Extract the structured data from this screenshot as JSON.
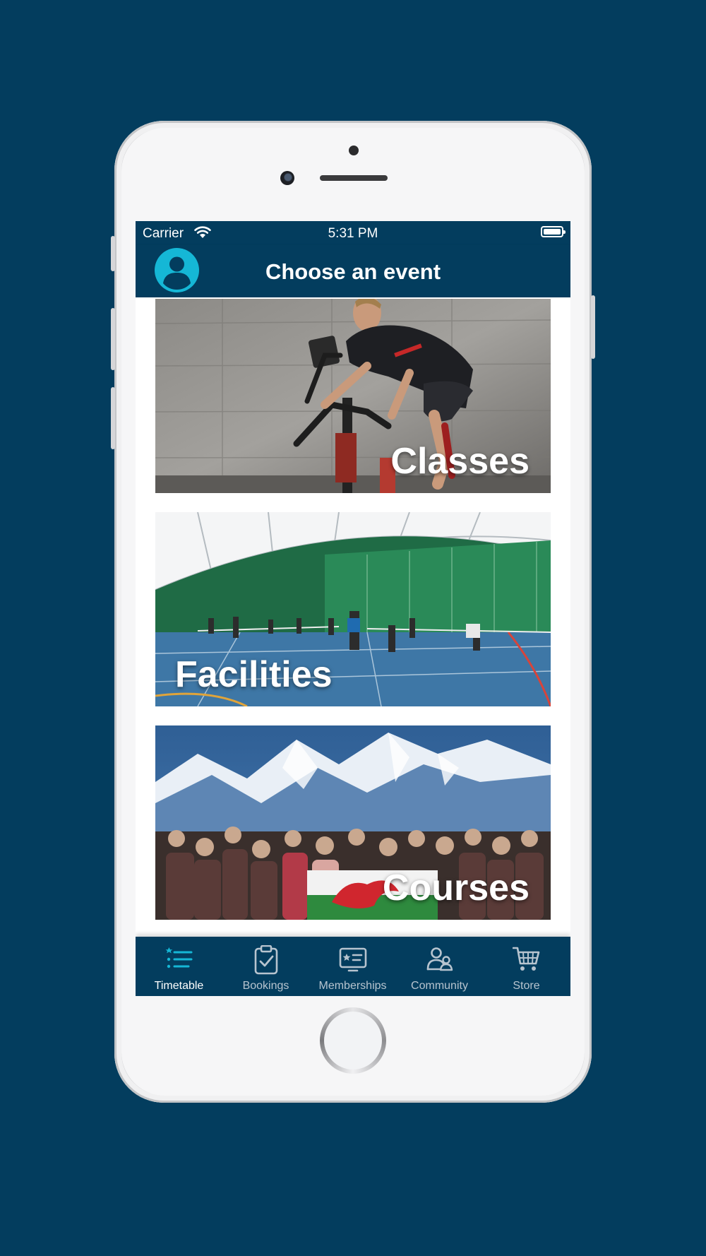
{
  "status_bar": {
    "carrier": "Carrier",
    "time": "5:31 PM"
  },
  "header": {
    "title": "Choose an event"
  },
  "cards": [
    {
      "label": "Classes"
    },
    {
      "label": "Facilities"
    },
    {
      "label": "Courses"
    }
  ],
  "tab_bar": {
    "items": [
      {
        "label": "Timetable",
        "icon": "timetable-list-icon",
        "active": true
      },
      {
        "label": "Bookings",
        "icon": "clipboard-check-icon",
        "active": false
      },
      {
        "label": "Memberships",
        "icon": "membership-card-icon",
        "active": false
      },
      {
        "label": "Community",
        "icon": "community-people-icon",
        "active": false
      },
      {
        "label": "Store",
        "icon": "shopping-cart-icon",
        "active": false
      }
    ]
  },
  "colors": {
    "background": "#033d5e",
    "accent": "#15b7d6",
    "tab_inactive": "#b7c4cf"
  }
}
